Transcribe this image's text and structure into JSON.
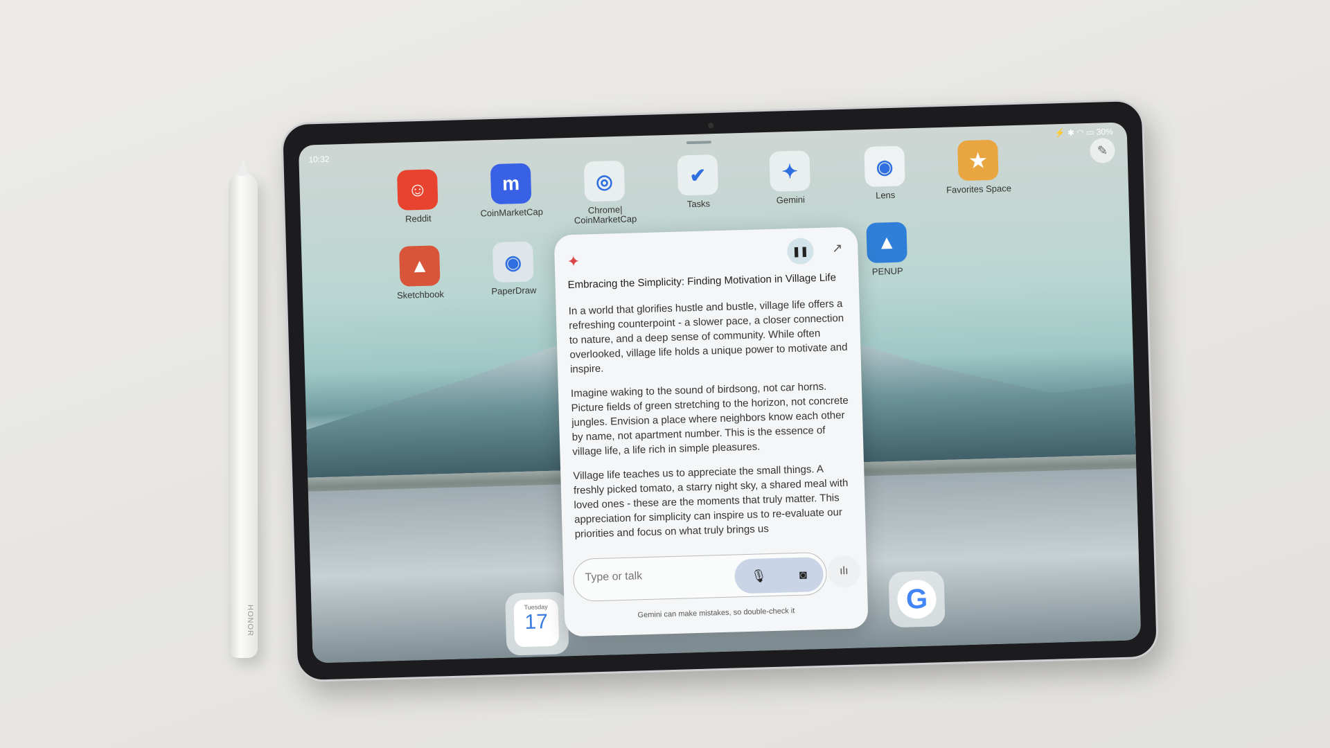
{
  "stylus": {
    "brand": "HONOR"
  },
  "status": {
    "time": "10:32",
    "battery": "30%"
  },
  "apps": [
    {
      "label": "Reddit",
      "icon": "reddit-icon",
      "color": "#e8432e",
      "glyph": "☺"
    },
    {
      "label": "CoinMarketCap",
      "icon": "coinmarketcap-icon",
      "color": "#3961e6",
      "glyph": "m"
    },
    {
      "label": "Chrome| CoinMarketCap",
      "icon": "chrome-coinmarketcap-pair-icon",
      "color": "#e9eeee",
      "glyph": "◎"
    },
    {
      "label": "Tasks",
      "icon": "tasks-icon",
      "color": "#e9eeee",
      "glyph": "✔"
    },
    {
      "label": "Gemini",
      "icon": "gemini-icon",
      "color": "#e9eeee",
      "glyph": "✦"
    },
    {
      "label": "Lens",
      "icon": "lens-icon",
      "color": "#eef2f2",
      "glyph": "◉"
    },
    {
      "label": "Favorites Space",
      "icon": "favorites-icon",
      "color": "#e9a640",
      "glyph": "★"
    },
    {
      "label": "Sketchbook",
      "icon": "sketchbook-icon",
      "color": "#d9553a",
      "glyph": "▲"
    },
    {
      "label": "PaperDraw",
      "icon": "paperdraw-icon",
      "color": "#dfe6ea",
      "glyph": "◉"
    },
    {
      "label": "PENUP",
      "icon": "penup-icon",
      "color": "#2f7fd8",
      "glyph": "▲"
    }
  ],
  "gemini": {
    "title": "Embracing the Simplicity: Finding Motivation in Village Life",
    "paragraphs": [
      "In a world that glorifies hustle and bustle, village life offers a refreshing counterpoint - a slower pace, a closer connection to nature, and a deep sense of community. While often overlooked, village life holds a unique power to motivate and inspire.",
      "Imagine waking to the sound of birdsong, not car horns. Picture fields of green stretching to the horizon, not concrete jungles. Envision a place where neighbors know each other by name, not apartment number. This is the essence of village life, a life rich in simple pleasures.",
      "Village life teaches us to appreciate the small things. A freshly picked tomato, a starry night sky, a shared meal with loved ones - these are the moments that truly matter. This appreciation for simplicity can inspire us to re-evaluate our priorities and focus on what truly brings us"
    ],
    "placeholder": "Type or talk",
    "disclaimer": "Gemini can make mistakes, so double-check it",
    "accent": "#d9464a"
  },
  "dock": {
    "calendar_day": "Tuesday",
    "calendar_date": "17"
  }
}
